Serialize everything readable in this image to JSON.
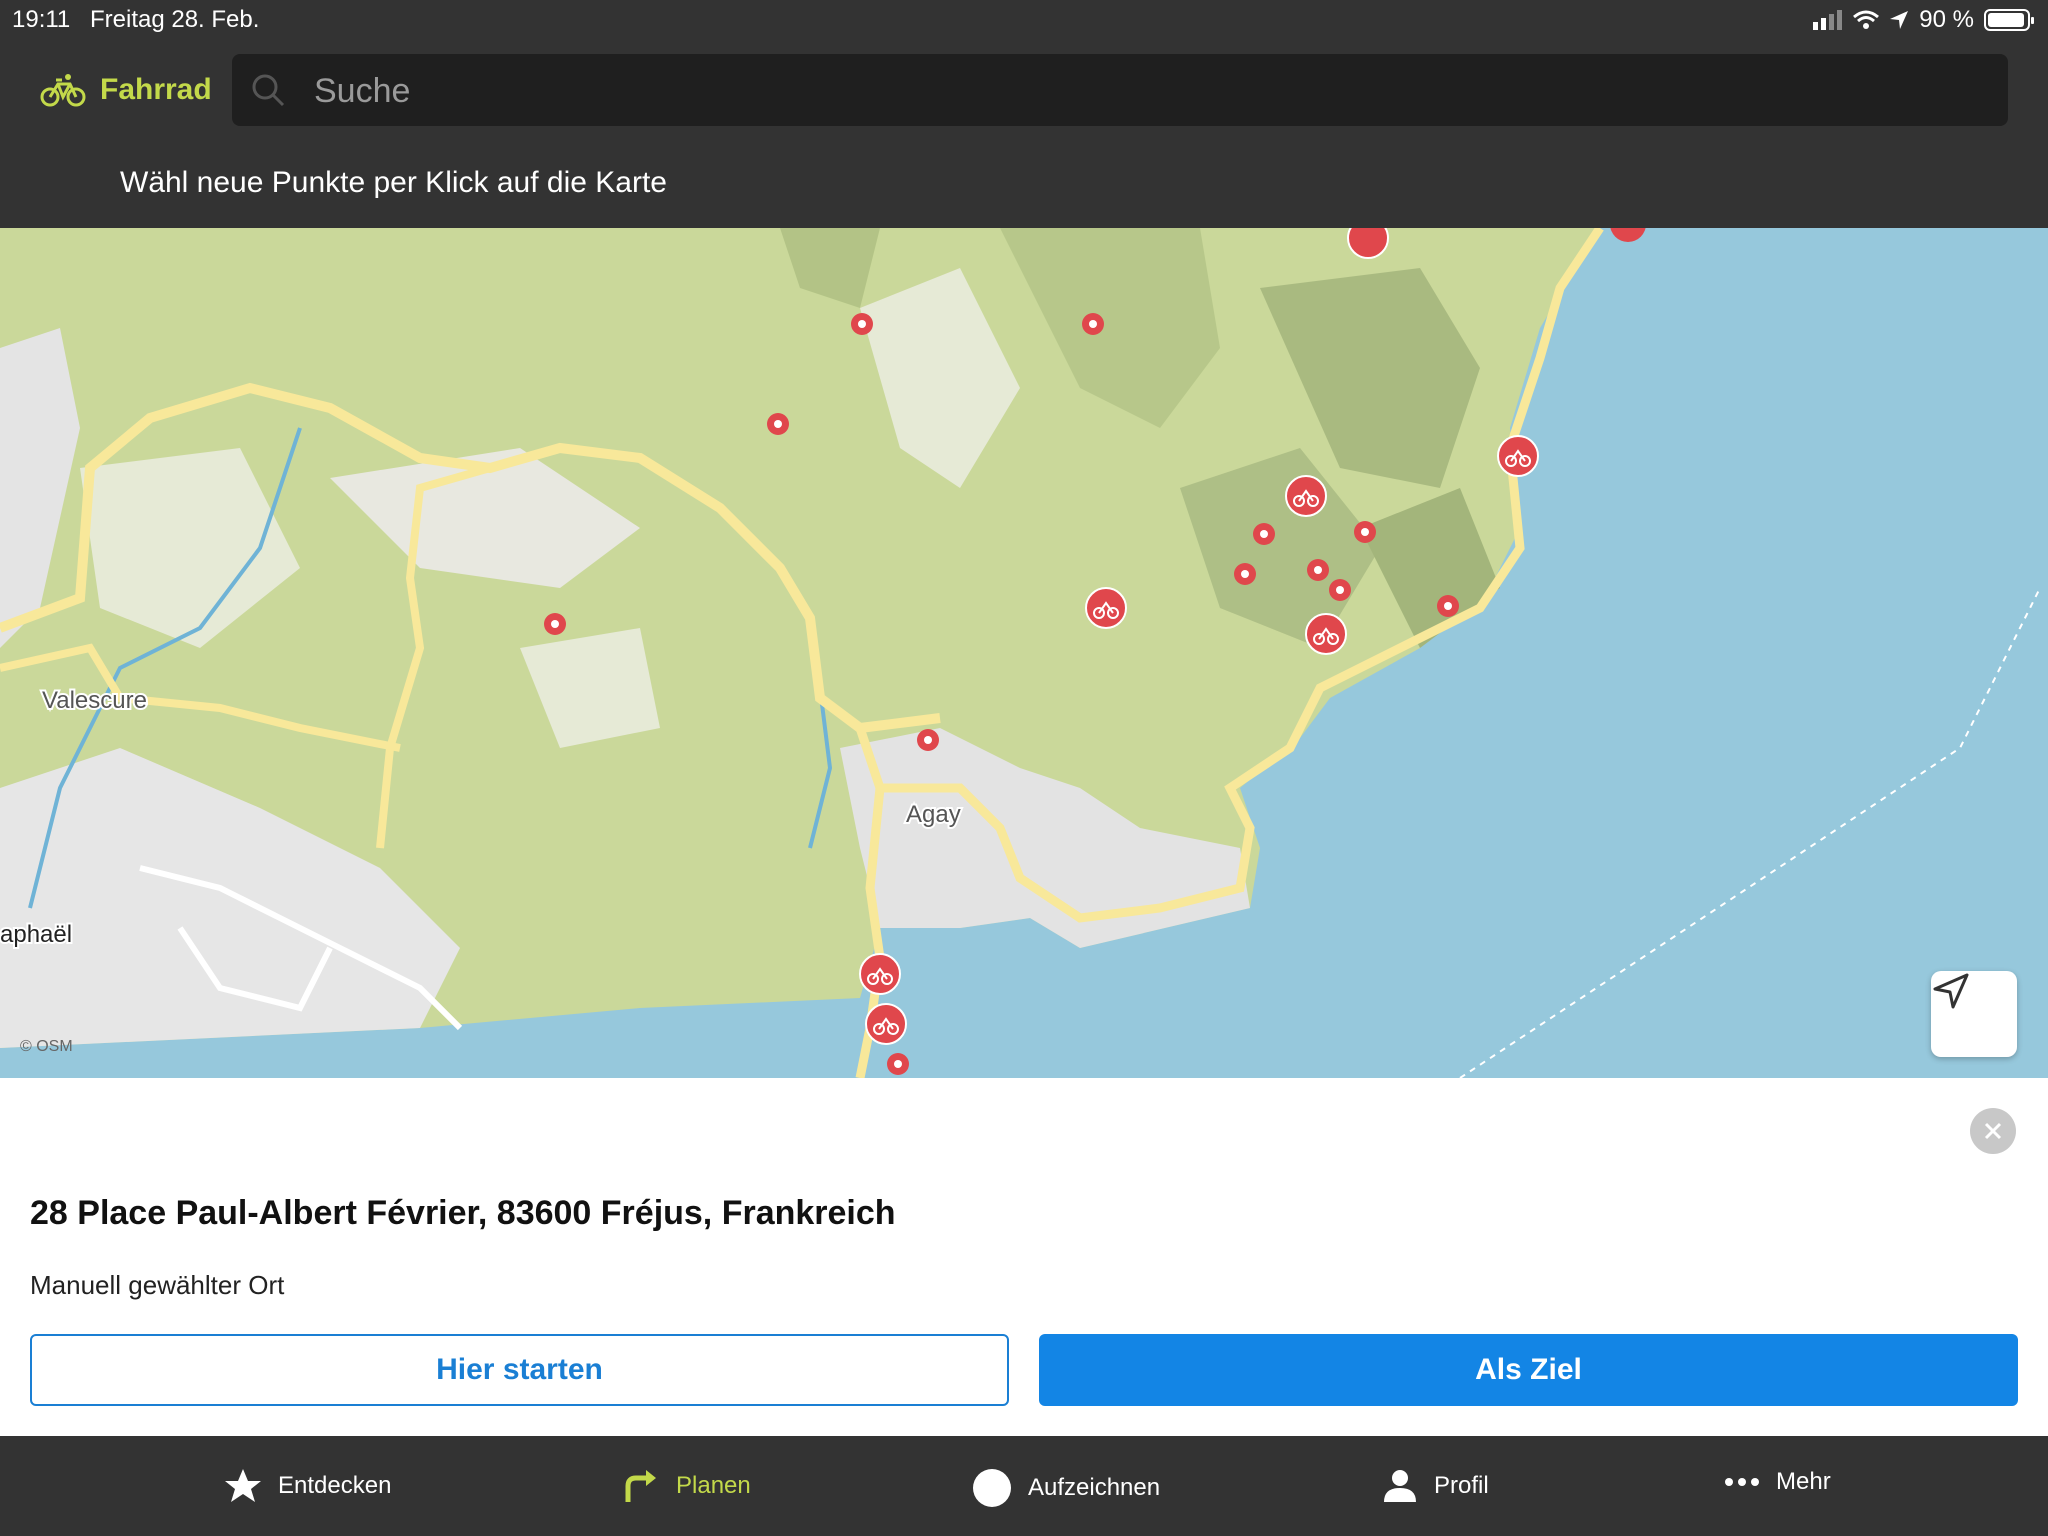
{
  "status": {
    "time": "19:11",
    "date": "Freitag 28. Feb.",
    "battery": "90 %"
  },
  "header": {
    "mode_label": "Fahrrad",
    "search_placeholder": "Suche",
    "hint": "Wähl neue Punkte per Klick auf die Karte"
  },
  "map": {
    "places": {
      "valescure": "Valescure",
      "agay": "Agay",
      "raphael": "aphaël"
    },
    "attribution": "© OSM"
  },
  "sheet": {
    "address": "28 Place Paul-Albert Février, 83600 Fréjus, Frankreich",
    "subtitle": "Manuell gewählter Ort",
    "start_button": "Hier starten",
    "destination_button": "Als Ziel"
  },
  "tabs": [
    {
      "label": "Entdecken",
      "icon": "star-icon"
    },
    {
      "label": "Planen",
      "icon": "route-arrow-icon"
    },
    {
      "label": "Aufzeichnen",
      "icon": "record-icon"
    },
    {
      "label": "Profil",
      "icon": "person-icon"
    },
    {
      "label": "Mehr",
      "icon": "more-dots-icon"
    }
  ],
  "colors": {
    "accent": "#c3d94a",
    "primary": "#1385e5",
    "chrome": "#333333",
    "water": "#96c8dc",
    "marker": "#e0474c"
  }
}
